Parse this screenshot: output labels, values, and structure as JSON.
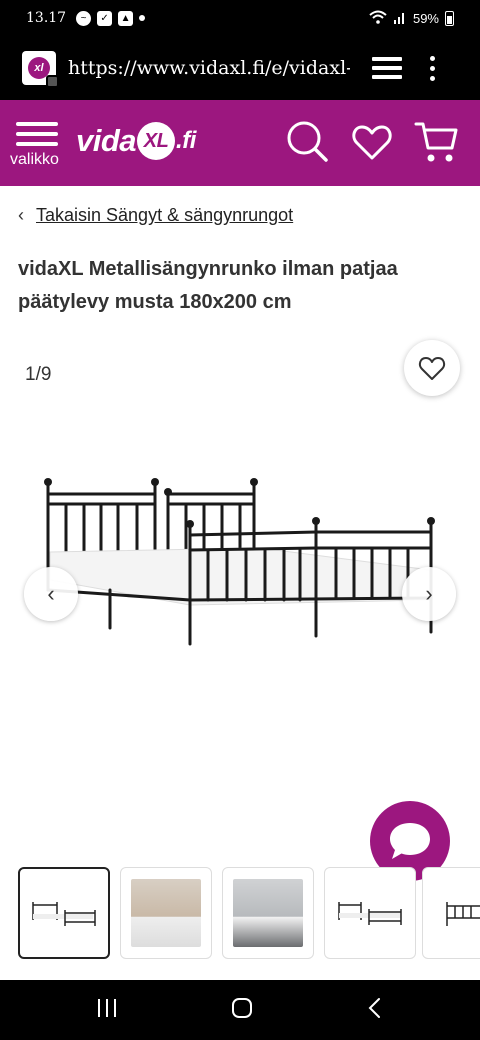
{
  "status_bar": {
    "time": "13.17",
    "battery": "59%"
  },
  "browser": {
    "url": "https://www.vidaxl.fi/e/vidaxl-m"
  },
  "header": {
    "menu_label": "valikko",
    "logo_prefix": "vida",
    "logo_xl": "XL",
    "logo_tld": ".fi"
  },
  "breadcrumb": {
    "chevron": "‹",
    "label": "Takaisin Sängyt & sängynrungot"
  },
  "product": {
    "title": "vidaXL Metallisängynrunko ilman patjaa päätylevy musta 180x200 cm",
    "image_counter": "1/9"
  },
  "gallery": {
    "prev": "‹",
    "next": "›",
    "thumbnails": [
      {
        "kind": "bed-white"
      },
      {
        "kind": "room-beige"
      },
      {
        "kind": "room-grey"
      },
      {
        "kind": "bed-white"
      },
      {
        "kind": "bed-white"
      }
    ]
  },
  "colors": {
    "brand": "#9c177f"
  },
  "icons": [
    "search-icon",
    "heart-icon",
    "cart-icon",
    "menu-icon",
    "chat-icon",
    "back-icon",
    "home-icon",
    "recent-apps-icon"
  ]
}
